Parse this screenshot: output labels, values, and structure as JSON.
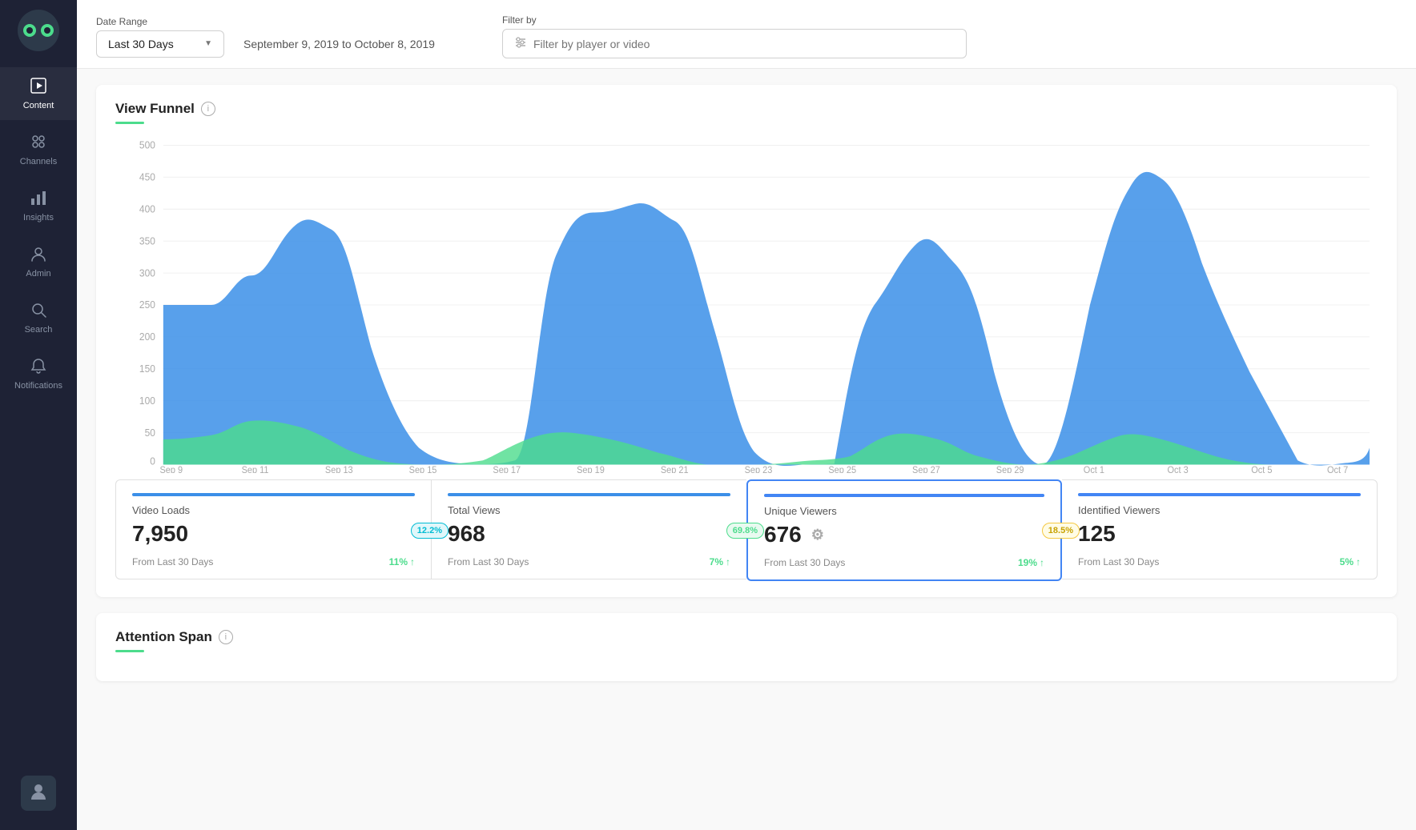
{
  "sidebar": {
    "logo_alt": "Wistia Logo",
    "items": [
      {
        "id": "content",
        "label": "Content",
        "icon": "▶",
        "active": true
      },
      {
        "id": "channels",
        "label": "Channels",
        "icon": "⊞",
        "active": false
      },
      {
        "id": "insights",
        "label": "Insights",
        "icon": "📊",
        "active": false
      },
      {
        "id": "admin",
        "label": "Admin",
        "icon": "👤",
        "active": false
      },
      {
        "id": "search",
        "label": "Search",
        "icon": "🔍",
        "active": false
      },
      {
        "id": "notifications",
        "label": "Notifications",
        "icon": "🔔",
        "active": false
      }
    ]
  },
  "controls": {
    "date_range_label": "Date Range",
    "date_range_value": "Last 30 Days",
    "date_range_display": "September 9, 2019 to October 8, 2019",
    "filter_label": "Filter by",
    "filter_placeholder": "Filter by player or video"
  },
  "view_funnel": {
    "title": "View Funnel",
    "underline_color": "#4cdc8c",
    "chart": {
      "y_labels": [
        "0",
        "50",
        "100",
        "150",
        "200",
        "250",
        "300",
        "350",
        "400",
        "450",
        "500"
      ],
      "x_labels": [
        "Sep 9",
        "Sep 11",
        "Sep 13",
        "Sep 15",
        "Sep 17",
        "Sep 19",
        "Sep 21",
        "Sep 23",
        "Sep 25",
        "Sep 27",
        "Sep 29",
        "Oct 1",
        "Oct 3",
        "Oct 5",
        "Oct 7"
      ],
      "blue_color": "#3b8fe8",
      "green_color": "#4cdc8c"
    },
    "stats": [
      {
        "id": "video-loads",
        "label": "Video Loads",
        "value": "7,950",
        "from_label": "From Last 30 Days",
        "change": "11%",
        "change_direction": "up",
        "funnel_bar_color": "#3b8fe8",
        "selected": false,
        "connector": {
          "value": "12.2%",
          "class": "fc-cyan"
        }
      },
      {
        "id": "total-views",
        "label": "Total Views",
        "value": "968",
        "from_label": "From Last 30 Days",
        "change": "7%",
        "change_direction": "up",
        "funnel_bar_color": "#3b8fe8",
        "selected": false,
        "connector": {
          "value": "69.8%",
          "class": "fc-green"
        }
      },
      {
        "id": "unique-viewers",
        "label": "Unique Viewers",
        "value": "676",
        "from_label": "From Last 30 Days",
        "change": "19%",
        "change_direction": "up",
        "funnel_bar_color": "#4285f4",
        "selected": true,
        "connector": {
          "value": "18.5%",
          "class": "fc-yellow"
        }
      },
      {
        "id": "identified-viewers",
        "label": "Identified Viewers",
        "value": "125",
        "from_label": "From Last 30 Days",
        "change": "5%",
        "change_direction": "up",
        "funnel_bar_color": "#4285f4",
        "selected": false,
        "connector": null
      }
    ]
  },
  "attention_span": {
    "title": "Attention Span",
    "underline_color": "#4cdc8c"
  }
}
